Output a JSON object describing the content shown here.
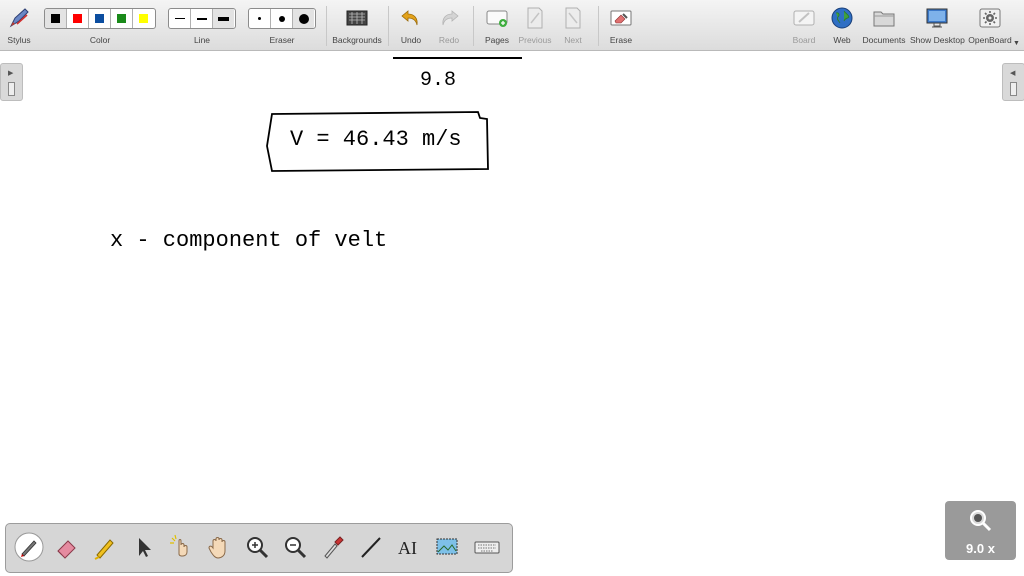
{
  "toolbar": {
    "stylus_label": "Stylus",
    "color_label": "Color",
    "line_label": "Line",
    "eraser_label": "Eraser",
    "backgrounds_label": "Backgrounds",
    "undo_label": "Undo",
    "redo_label": "Redo",
    "pages_label": "Pages",
    "previous_label": "Previous",
    "next_label": "Next",
    "erase_label": "Erase",
    "board_label": "Board",
    "web_label": "Web",
    "documents_label": "Documents",
    "show_desktop_label": "Show Desktop",
    "openboard_label": "OpenBoard",
    "colors": [
      "#000000",
      "#ff0000",
      "#0c4ea0",
      "#1a8a1a",
      "#ffff00"
    ]
  },
  "board": {
    "fraction_denominator": "9.8",
    "result_text": "V = 46.43 m/s",
    "heading_text": "x - component of velt"
  },
  "bottom_tools": [
    "pen-icon",
    "eraser-icon",
    "highlighter-icon",
    "pointer-icon",
    "laser-icon",
    "hand-icon",
    "zoom-in-icon",
    "zoom-out-icon",
    "pipette-icon",
    "line-icon",
    "text-icon",
    "capture-icon",
    "keyboard-icon"
  ],
  "zoom": {
    "value": "9.0 x"
  }
}
